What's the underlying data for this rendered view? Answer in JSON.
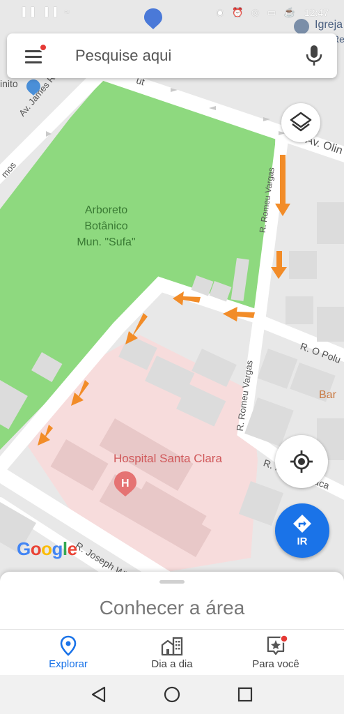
{
  "status_bar": {
    "time": "12:47",
    "icons_left": "▐▐ ▐▐ ≈",
    "icons_right": "◉ ⏰ ◎ ▭ ☕"
  },
  "search": {
    "placeholder": "Pesquise aqui",
    "menu_icon": "hamburger-icon",
    "mic_icon": "microphone-icon"
  },
  "map": {
    "labels": {
      "park": [
        "Arboreto",
        "Botânico",
        "Mun. \"Sufa\""
      ],
      "hospital": "Hospital Santa Clara",
      "igreja": "Igreja",
      "igreja_r": "Re",
      "inito": "inito",
      "av_james": "Av. James R A",
      "av_olin": "Av. Olin",
      "r_romeu_top": "R. Romeu Vargas",
      "r_romeu_bottom": "R. Romeu Vargas",
      "r_o_polu": "R. O Polu",
      "bar": "Bar",
      "r_macae": "R. Fr... de Maca",
      "r_joseph": "R. Joseph Willia",
      "mos": "mos",
      "street_top": "ut"
    },
    "colors": {
      "park": "#8ed97f",
      "hospital": "#f7dcdc",
      "road": "#ffffff",
      "arrow": "#f28c28",
      "building": "#dcdcdc"
    }
  },
  "buttons": {
    "layers_icon": "layers-icon",
    "locate_icon": "my-location-icon",
    "go_label": "IR"
  },
  "google_logo": [
    "G",
    "o",
    "o",
    "g",
    "l",
    "e"
  ],
  "sheet": {
    "title": "Conhecer a área"
  },
  "nav": {
    "items": [
      {
        "label": "Explorar",
        "icon": "explore-pin-icon",
        "active": true
      },
      {
        "label": "Dia a dia",
        "icon": "commute-icon",
        "active": false
      },
      {
        "label": "Para você",
        "icon": "for-you-icon",
        "active": false
      }
    ]
  },
  "system_nav": {
    "back": "back-icon",
    "home": "home-icon",
    "recents": "recents-icon"
  }
}
